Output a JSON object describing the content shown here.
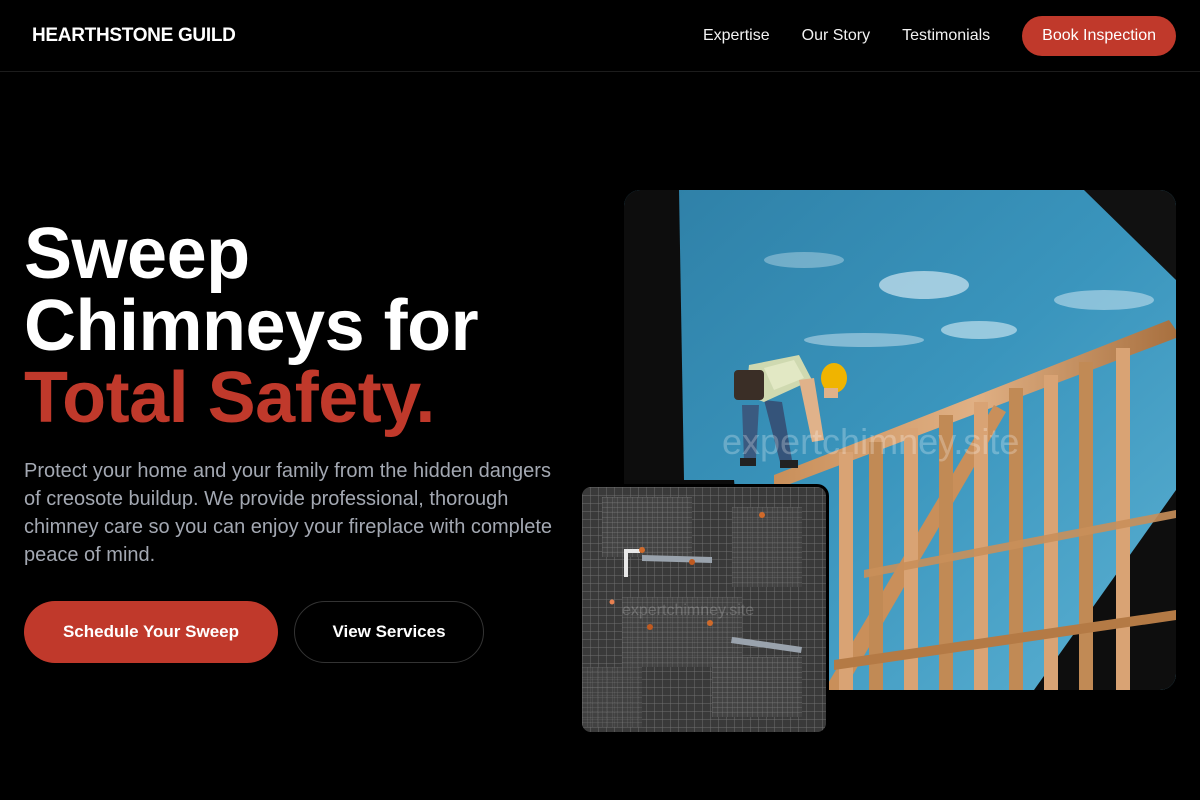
{
  "brand": {
    "name": "HEARTHSTONE GUILD"
  },
  "nav": {
    "links": [
      "Expertise",
      "Our Story",
      "Testimonials"
    ],
    "cta_label": "Book Inspection"
  },
  "hero": {
    "title_line1": "Sweep",
    "title_line2": "Chimneys for",
    "title_accent": "Total Safety.",
    "description": "Protect your home and your family from the hidden dangers of creosote buildup. We provide professional, thorough chimney care so you can enjoy your fireplace with complete peace of mind.",
    "primary_button": "Schedule Your Sweep",
    "secondary_button": "View Services"
  },
  "images": {
    "main": {
      "icon": "roofer-on-frame-photo",
      "watermark": "expertchimney.site"
    },
    "inset": {
      "icon": "aerial-rebar-grid-photo",
      "watermark": "expertchimney.site"
    }
  },
  "colors": {
    "accent": "#c0392b",
    "background": "#000000",
    "muted_text": "#a3a8b2"
  }
}
